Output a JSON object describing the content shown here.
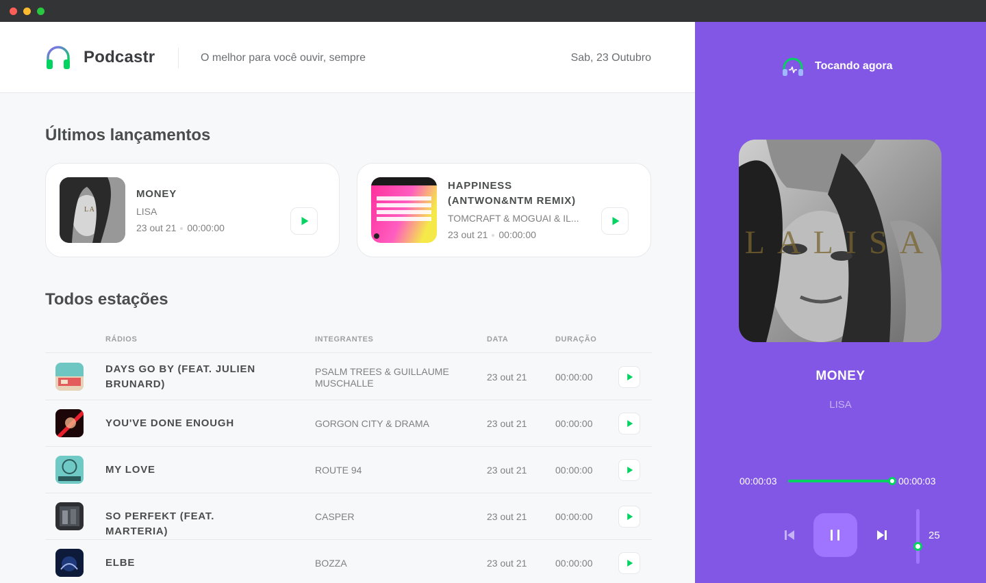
{
  "header": {
    "brand": "Podcastr",
    "tagline": "O melhor para você ouvir, sempre",
    "date": "Sab, 23 Outubro"
  },
  "latest": {
    "title": "Últimos lançamentos",
    "episodes": [
      {
        "title": "MONEY",
        "artist": "LISA",
        "date": "23 out 21",
        "duration": "00:00:00"
      },
      {
        "title": "HAPPINESS (ANTWON&NTM REMIX)",
        "artist": "TOMCRAFT & MOGUAI & IL...",
        "date": "23 out 21",
        "duration": "00:00:00"
      }
    ]
  },
  "all": {
    "title": "Todos estações",
    "columns": {
      "radios": "RÁDIOS",
      "members": "INTEGRANTES",
      "date": "DATA",
      "duration": "DURAÇÃO"
    },
    "rows": [
      {
        "title": "DAYS GO BY (FEAT. JULIEN BRUNARD)",
        "artist": "PSALM TREES & GUILLAUME MUSCHALLE",
        "date": "23 out 21",
        "duration": "00:00:00"
      },
      {
        "title": "YOU'VE DONE ENOUGH",
        "artist": "GORGON CITY & DRAMA",
        "date": "23 out 21",
        "duration": "00:00:00"
      },
      {
        "title": "MY LOVE",
        "artist": "ROUTE 94",
        "date": "23 out 21",
        "duration": "00:00:00"
      },
      {
        "title": "SO PERFEKT (FEAT. MARTERIA)",
        "artist": "CASPER",
        "date": "23 out 21",
        "duration": "00:00:00"
      },
      {
        "title": "ELBE",
        "artist": "BOZZA",
        "date": "23 out 21",
        "duration": "00:00:00"
      }
    ]
  },
  "player": {
    "heading": "Tocando agora",
    "cover_text": "LALISA",
    "title": "MONEY",
    "artist": "LISA",
    "current_time": "00:00:03",
    "total_time": "00:00:03",
    "progress_percent": 100,
    "volume": "25",
    "volume_fraction": 0.25
  },
  "colors": {
    "accent_purple": "#8257e5",
    "light_purple": "#9f75ff",
    "green": "#04d361"
  },
  "icons": {
    "logo": "headphones-icon",
    "play": "play-icon",
    "pause": "pause-icon",
    "previous": "skip-previous-icon",
    "next": "skip-next-icon",
    "now_playing": "headphones-icon"
  }
}
